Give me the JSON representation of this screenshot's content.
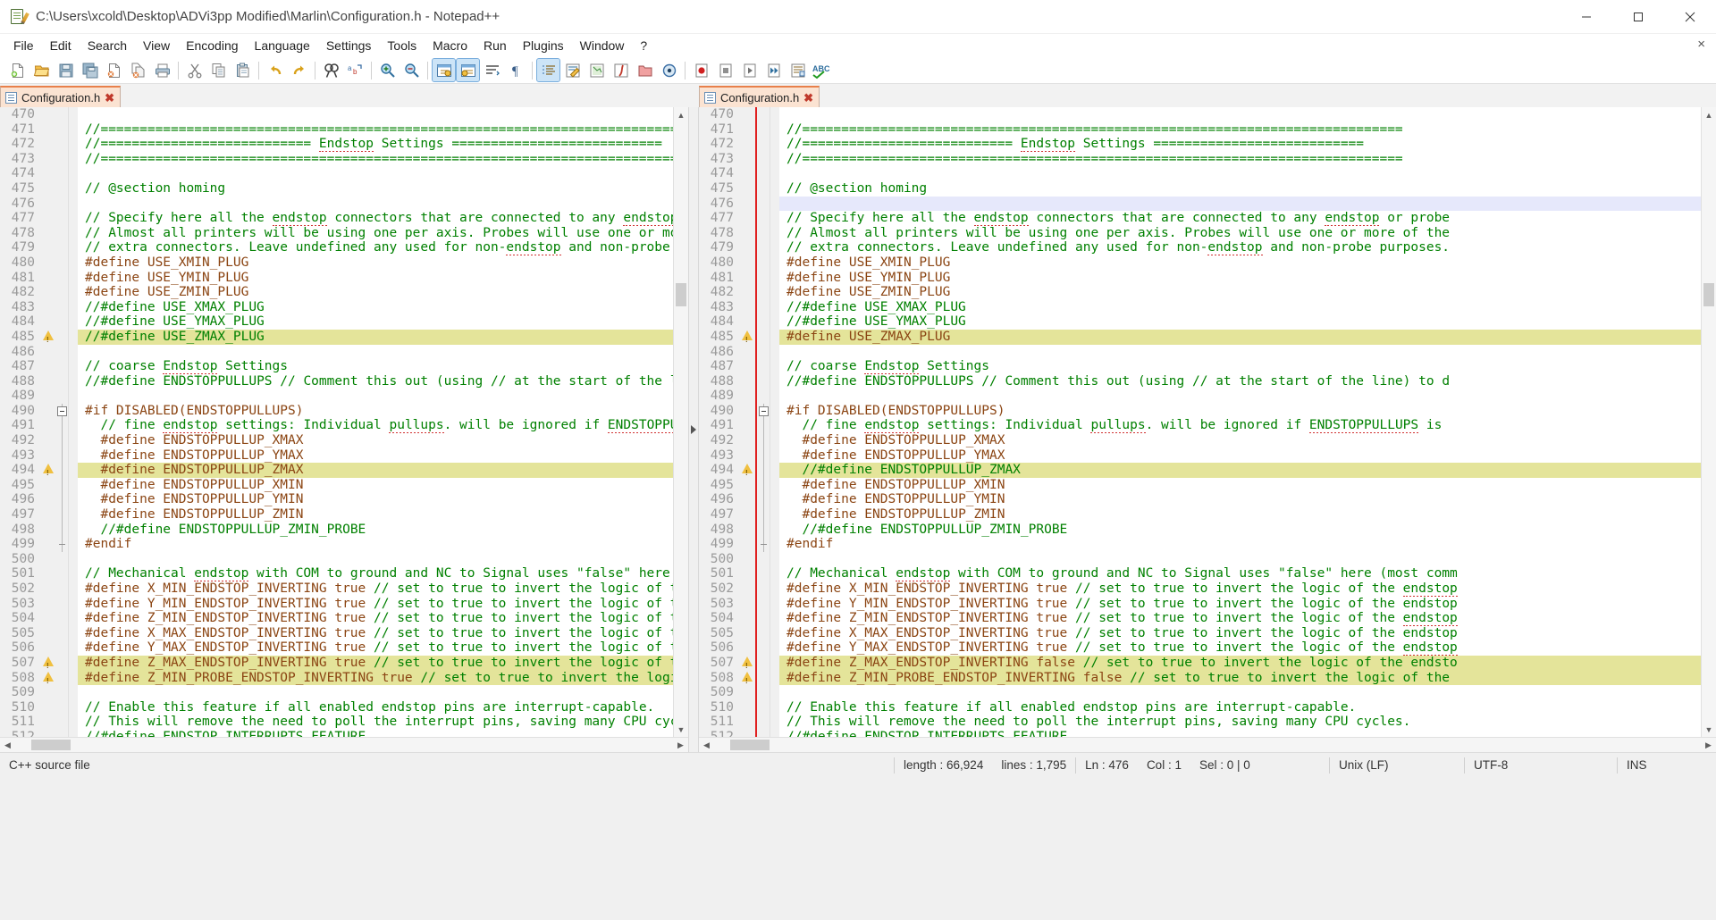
{
  "window": {
    "title": "C:\\Users\\xcold\\Desktop\\ADVi3pp Modified\\Marlin\\Configuration.h - Notepad++",
    "icon": "notepad-plus-plus-icon",
    "minimize_label": "Minimize",
    "maximize_label": "Maximize",
    "close_label": "Close"
  },
  "menubar": {
    "items": [
      {
        "label": "File"
      },
      {
        "label": "Edit"
      },
      {
        "label": "Search"
      },
      {
        "label": "View"
      },
      {
        "label": "Encoding"
      },
      {
        "label": "Language"
      },
      {
        "label": "Settings"
      },
      {
        "label": "Tools"
      },
      {
        "label": "Macro"
      },
      {
        "label": "Run"
      },
      {
        "label": "Plugins"
      },
      {
        "label": "Window"
      },
      {
        "label": "?"
      }
    ],
    "doc_close_label": "×"
  },
  "toolbar": {
    "buttons": [
      {
        "name": "new-file-icon",
        "title": "New"
      },
      {
        "name": "open-file-icon",
        "title": "Open"
      },
      {
        "name": "save-icon",
        "title": "Save"
      },
      {
        "name": "save-all-icon",
        "title": "Save All"
      },
      {
        "name": "close-document-icon",
        "title": "Close"
      },
      {
        "name": "close-all-icon",
        "title": "Close All"
      },
      {
        "name": "print-icon",
        "title": "Print"
      },
      {
        "name": "cut-icon",
        "title": "Cut"
      },
      {
        "name": "copy-icon",
        "title": "Copy"
      },
      {
        "name": "paste-icon",
        "title": "Paste"
      },
      {
        "name": "undo-icon",
        "title": "Undo"
      },
      {
        "name": "redo-icon",
        "title": "Redo"
      },
      {
        "name": "find-icon",
        "title": "Find"
      },
      {
        "name": "replace-icon",
        "title": "Replace"
      },
      {
        "name": "zoom-in-icon",
        "title": "Zoom In"
      },
      {
        "name": "zoom-out-icon",
        "title": "Zoom Out"
      },
      {
        "name": "sync-vertical-scroll-icon",
        "title": "Synchronize Vertical Scrolling"
      },
      {
        "name": "sync-horizontal-scroll-icon",
        "title": "Synchronize Horizontal Scrolling"
      },
      {
        "name": "word-wrap-icon",
        "title": "Word wrap"
      },
      {
        "name": "show-all-characters-icon",
        "title": "Show All Characters"
      },
      {
        "name": "indent-guide-icon",
        "title": "Show Indent Guide"
      },
      {
        "name": "user-defined-language-icon",
        "title": "User-Defined Dialogue"
      },
      {
        "name": "document-map-icon",
        "title": "Document Map"
      },
      {
        "name": "function-list-icon",
        "title": "Function List"
      },
      {
        "name": "folder-as-workspace-icon",
        "title": "Folder as Workspace"
      },
      {
        "name": "monitoring-icon",
        "title": "Monitoring"
      },
      {
        "name": "record-macro-icon",
        "title": "Start Recording"
      },
      {
        "name": "stop-macro-icon",
        "title": "Stop Recording"
      },
      {
        "name": "play-macro-icon",
        "title": "Playback"
      },
      {
        "name": "play-multiple-macro-icon",
        "title": "Run a Macro Multiple Times"
      },
      {
        "name": "save-macro-icon",
        "title": "Save Currently Recorded Macro"
      },
      {
        "name": "spell-check-icon",
        "title": "Spell Check"
      }
    ]
  },
  "tabs": {
    "left": {
      "label": "Configuration.h",
      "icon": "file-icon",
      "close": "✖"
    },
    "right": {
      "label": "Configuration.h",
      "icon": "file-icon",
      "close": "✖"
    }
  },
  "statusbar": {
    "language": "C++ source file",
    "length_label": "length : 66,924",
    "lines_label": "lines : 1,795",
    "ln_label": "Ln : 476",
    "col_label": "Col : 1",
    "sel_label": "Sel : 0 | 0",
    "eol": "Unix (LF)",
    "encoding": "UTF-8",
    "insert_mode": "INS"
  },
  "editor": {
    "first_line": 470,
    "left_pane": {
      "scroll_x": 0,
      "lines": [
        {
          "n": 470,
          "text": ""
        },
        {
          "n": 471,
          "text": "//============================================================================="
        },
        {
          "n": 472,
          "text": "//=========================== Endstop Settings ==========================="
        },
        {
          "n": 473,
          "text": "//============================================================================="
        },
        {
          "n": 474,
          "text": ""
        },
        {
          "n": 475,
          "text": "// @section homing"
        },
        {
          "n": 476,
          "text": ""
        },
        {
          "n": 477,
          "text": "// Specify here all the endstop connectors that are connected to any endstop or pro"
        },
        {
          "n": 478,
          "text": "// Almost all printers will be using one per axis. Probes will use one or more of t"
        },
        {
          "n": 479,
          "text": "// extra connectors. Leave undefined any used for non-endstop and non-probe purpose"
        },
        {
          "n": 480,
          "text": "#define USE_XMIN_PLUG"
        },
        {
          "n": 481,
          "text": "#define USE_YMIN_PLUG"
        },
        {
          "n": 482,
          "text": "#define USE_ZMIN_PLUG"
        },
        {
          "n": 483,
          "text": "//#define USE_XMAX_PLUG"
        },
        {
          "n": 484,
          "text": "//#define USE_YMAX_PLUG"
        },
        {
          "n": 485,
          "text": "//#define USE_ZMAX_PLUG",
          "highlight": "yellow",
          "warn": true
        },
        {
          "n": 486,
          "text": ""
        },
        {
          "n": 487,
          "text": "// coarse Endstop Settings"
        },
        {
          "n": 488,
          "text": "//#define ENDSTOPPULLUPS // Comment this out (using // at the start of the line) to"
        },
        {
          "n": 489,
          "text": ""
        },
        {
          "n": 490,
          "text": "#if DISABLED(ENDSTOPPULLUPS)",
          "fold": "open"
        },
        {
          "n": 491,
          "text": "  // fine endstop settings: Individual pullups. will be ignored if ENDSTOPPULLUPS i"
        },
        {
          "n": 492,
          "text": "  #define ENDSTOPPULLUP_XMAX"
        },
        {
          "n": 493,
          "text": "  #define ENDSTOPPULLUP_YMAX"
        },
        {
          "n": 494,
          "text": "  #define ENDSTOPPULLUP_ZMAX",
          "highlight": "yellow",
          "warn": true
        },
        {
          "n": 495,
          "text": "  #define ENDSTOPPULLUP_XMIN"
        },
        {
          "n": 496,
          "text": "  #define ENDSTOPPULLUP_YMIN"
        },
        {
          "n": 497,
          "text": "  #define ENDSTOPPULLUP_ZMIN"
        },
        {
          "n": 498,
          "text": "  //#define ENDSTOPPULLUP_ZMIN_PROBE"
        },
        {
          "n": 499,
          "text": "#endif",
          "fold": "end"
        },
        {
          "n": 500,
          "text": ""
        },
        {
          "n": 501,
          "text": "// Mechanical endstop with COM to ground and NC to Signal uses \"false\" here (most c"
        },
        {
          "n": 502,
          "text": "#define X_MIN_ENDSTOP_INVERTING true // set to true to invert the logic of the ends"
        },
        {
          "n": 503,
          "text": "#define Y_MIN_ENDSTOP_INVERTING true // set to true to invert the logic of the ends"
        },
        {
          "n": 504,
          "text": "#define Z_MIN_ENDSTOP_INVERTING true // set to true to invert the logic of the ends"
        },
        {
          "n": 505,
          "text": "#define X_MAX_ENDSTOP_INVERTING true // set to true to invert the logic of the ends"
        },
        {
          "n": 506,
          "text": "#define Y_MAX_ENDSTOP_INVERTING true // set to true to invert the logic of the ends"
        },
        {
          "n": 507,
          "text": "#define Z_MAX_ENDSTOP_INVERTING true // set to true to invert the logic of the ends",
          "highlight": "yellow",
          "warn": true
        },
        {
          "n": 508,
          "text": "#define Z_MIN_PROBE_ENDSTOP_INVERTING true // set to true to invert the logic of th",
          "highlight": "yellow",
          "warn": true
        },
        {
          "n": 509,
          "text": ""
        },
        {
          "n": 510,
          "text": "// Enable this feature if all enabled endstop pins are interrupt-capable."
        },
        {
          "n": 511,
          "text": "// This will remove the need to poll the interrupt pins, saving many CPU cycles."
        },
        {
          "n": 512,
          "text": "//#define ENDSTOP_INTERRUPTS_FEATURE"
        }
      ]
    },
    "right_pane": {
      "scroll_x": 0,
      "lines": [
        {
          "n": 470,
          "text": ""
        },
        {
          "n": 471,
          "text": "//============================================================================="
        },
        {
          "n": 472,
          "text": "//=========================== Endstop Settings ==========================="
        },
        {
          "n": 473,
          "text": "//============================================================================="
        },
        {
          "n": 474,
          "text": ""
        },
        {
          "n": 475,
          "text": "// @section homing"
        },
        {
          "n": 476,
          "text": "",
          "highlight": "blue"
        },
        {
          "n": 477,
          "text": "// Specify here all the endstop connectors that are connected to any endstop or probe"
        },
        {
          "n": 478,
          "text": "// Almost all printers will be using one per axis. Probes will use one or more of the"
        },
        {
          "n": 479,
          "text": "// extra connectors. Leave undefined any used for non-endstop and non-probe purposes."
        },
        {
          "n": 480,
          "text": "#define USE_XMIN_PLUG"
        },
        {
          "n": 481,
          "text": "#define USE_YMIN_PLUG"
        },
        {
          "n": 482,
          "text": "#define USE_ZMIN_PLUG"
        },
        {
          "n": 483,
          "text": "//#define USE_XMAX_PLUG"
        },
        {
          "n": 484,
          "text": "//#define USE_YMAX_PLUG"
        },
        {
          "n": 485,
          "text": "#define USE_ZMAX_PLUG",
          "highlight": "yellow",
          "warn": true
        },
        {
          "n": 486,
          "text": ""
        },
        {
          "n": 487,
          "text": "// coarse Endstop Settings"
        },
        {
          "n": 488,
          "text": "//#define ENDSTOPPULLUPS // Comment this out (using // at the start of the line) to d"
        },
        {
          "n": 489,
          "text": ""
        },
        {
          "n": 490,
          "text": "#if DISABLED(ENDSTOPPULLUPS)",
          "fold": "open"
        },
        {
          "n": 491,
          "text": "  // fine endstop settings: Individual pullups. will be ignored if ENDSTOPPULLUPS is "
        },
        {
          "n": 492,
          "text": "  #define ENDSTOPPULLUP_XMAX"
        },
        {
          "n": 493,
          "text": "  #define ENDSTOPPULLUP_YMAX"
        },
        {
          "n": 494,
          "text": "  //#define ENDSTOPPULLUP_ZMAX",
          "highlight": "yellow",
          "warn": true
        },
        {
          "n": 495,
          "text": "  #define ENDSTOPPULLUP_XMIN"
        },
        {
          "n": 496,
          "text": "  #define ENDSTOPPULLUP_YMIN"
        },
        {
          "n": 497,
          "text": "  #define ENDSTOPPULLUP_ZMIN"
        },
        {
          "n": 498,
          "text": "  //#define ENDSTOPPULLUP_ZMIN_PROBE"
        },
        {
          "n": 499,
          "text": "#endif",
          "fold": "end"
        },
        {
          "n": 500,
          "text": ""
        },
        {
          "n": 501,
          "text": "// Mechanical endstop with COM to ground and NC to Signal uses \"false\" here (most comm"
        },
        {
          "n": 502,
          "text": "#define X_MIN_ENDSTOP_INVERTING true // set to true to invert the logic of the endstop"
        },
        {
          "n": 503,
          "text": "#define Y_MIN_ENDSTOP_INVERTING true // set to true to invert the logic of the endstop"
        },
        {
          "n": 504,
          "text": "#define Z_MIN_ENDSTOP_INVERTING true // set to true to invert the logic of the endstop"
        },
        {
          "n": 505,
          "text": "#define X_MAX_ENDSTOP_INVERTING true // set to true to invert the logic of the endstop"
        },
        {
          "n": 506,
          "text": "#define Y_MAX_ENDSTOP_INVERTING true // set to true to invert the logic of the endstop"
        },
        {
          "n": 507,
          "text": "#define Z_MAX_ENDSTOP_INVERTING false // set to true to invert the logic of the endsto",
          "highlight": "yellow",
          "warn": true
        },
        {
          "n": 508,
          "text": "#define Z_MIN_PROBE_ENDSTOP_INVERTING false // set to true to invert the logic of the ",
          "highlight": "yellow",
          "warn": true
        },
        {
          "n": 509,
          "text": ""
        },
        {
          "n": 510,
          "text": "// Enable this feature if all enabled endstop pins are interrupt-capable."
        },
        {
          "n": 511,
          "text": "// This will remove the need to poll the interrupt pins, saving many CPU cycles."
        },
        {
          "n": 512,
          "text": "//#define ENDSTOP_INTERRUPTS_FEATURE"
        }
      ]
    }
  },
  "colors": {
    "comment": "#008000",
    "preprocessor": "#8b4513",
    "highlight_yellow": "#e4e49a",
    "highlight_blue": "#e6e8fb",
    "mark_word": "#c6c68a",
    "change_marker_red": "#e02020",
    "tab_active_orange": "#e8804b"
  }
}
